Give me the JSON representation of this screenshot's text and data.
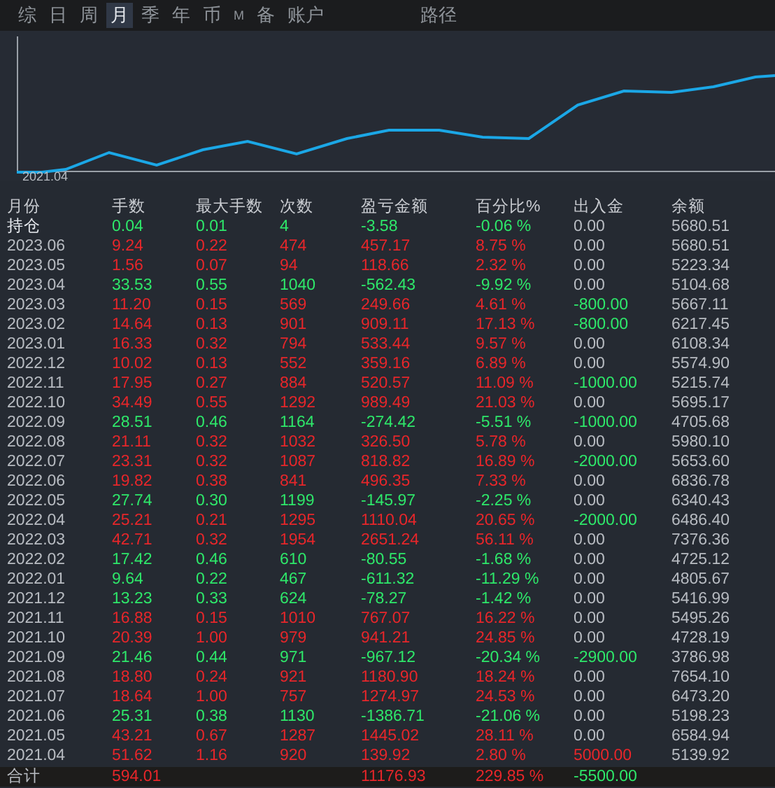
{
  "tabs": [
    {
      "label": "综",
      "selected": false
    },
    {
      "label": "日",
      "selected": false
    },
    {
      "label": "周",
      "selected": false
    },
    {
      "label": "月",
      "selected": true
    },
    {
      "label": "季",
      "selected": false
    },
    {
      "label": "年",
      "selected": false
    },
    {
      "label": "币",
      "selected": false
    },
    {
      "label": "M",
      "selected": false,
      "kind": "small"
    },
    {
      "label": "备",
      "selected": false
    },
    {
      "label": "账户",
      "selected": false
    },
    {
      "label": "路径",
      "selected": false,
      "kind": "far"
    }
  ],
  "chart": {
    "start_label": "2021.04"
  },
  "table": {
    "columns": [
      "月份",
      "手数",
      "最大手数",
      "次数",
      "盈亏金额",
      "百分比%",
      "出入金",
      "余额"
    ],
    "rows": [
      {
        "cells": [
          "持仓",
          "0.04",
          "0.01",
          "4",
          "-3.58",
          "-0.06 %",
          "0.00",
          "5680.51"
        ],
        "kind": "loss",
        "deposit": {
          "kind": "none"
        }
      },
      {
        "cells": [
          "2023.06",
          "9.24",
          "0.22",
          "474",
          "457.17",
          "8.75 %",
          "0.00",
          "5680.51"
        ],
        "kind": "gain",
        "deposit": {
          "kind": "none"
        }
      },
      {
        "cells": [
          "2023.05",
          "1.56",
          "0.07",
          "94",
          "118.66",
          "2.32 %",
          "0.00",
          "5223.34"
        ],
        "kind": "gain",
        "deposit": {
          "kind": "none"
        }
      },
      {
        "cells": [
          "2023.04",
          "33.53",
          "0.55",
          "1040",
          "-562.43",
          "-9.92 %",
          "0.00",
          "5104.68"
        ],
        "kind": "loss",
        "deposit": {
          "kind": "none"
        }
      },
      {
        "cells": [
          "2023.03",
          "11.20",
          "0.15",
          "569",
          "249.66",
          "4.61 %",
          "-800.00",
          "5667.11"
        ],
        "kind": "gain",
        "deposit": {
          "kind": "out"
        }
      },
      {
        "cells": [
          "2023.02",
          "14.64",
          "0.13",
          "901",
          "909.11",
          "17.13 %",
          "-800.00",
          "6217.45"
        ],
        "kind": "gain",
        "deposit": {
          "kind": "out"
        }
      },
      {
        "cells": [
          "2023.01",
          "16.33",
          "0.32",
          "794",
          "533.44",
          "9.57 %",
          "0.00",
          "6108.34"
        ],
        "kind": "gain",
        "deposit": {
          "kind": "none"
        }
      },
      {
        "cells": [
          "2022.12",
          "10.02",
          "0.13",
          "552",
          "359.16",
          "6.89 %",
          "0.00",
          "5574.90"
        ],
        "kind": "gain",
        "deposit": {
          "kind": "none"
        }
      },
      {
        "cells": [
          "2022.11",
          "17.95",
          "0.27",
          "884",
          "520.57",
          "11.09 %",
          "-1000.00",
          "5215.74"
        ],
        "kind": "gain",
        "deposit": {
          "kind": "out"
        }
      },
      {
        "cells": [
          "2022.10",
          "34.49",
          "0.55",
          "1292",
          "989.49",
          "21.03 %",
          "0.00",
          "5695.17"
        ],
        "kind": "gain",
        "deposit": {
          "kind": "none"
        }
      },
      {
        "cells": [
          "2022.09",
          "28.51",
          "0.46",
          "1164",
          "-274.42",
          "-5.51 %",
          "-1000.00",
          "4705.68"
        ],
        "kind": "loss",
        "deposit": {
          "kind": "out"
        }
      },
      {
        "cells": [
          "2022.08",
          "21.11",
          "0.32",
          "1032",
          "326.50",
          "5.78 %",
          "0.00",
          "5980.10"
        ],
        "kind": "gain",
        "deposit": {
          "kind": "none"
        }
      },
      {
        "cells": [
          "2022.07",
          "23.31",
          "0.32",
          "1087",
          "818.82",
          "16.89 %",
          "-2000.00",
          "5653.60"
        ],
        "kind": "gain",
        "deposit": {
          "kind": "out"
        }
      },
      {
        "cells": [
          "2022.06",
          "19.82",
          "0.38",
          "841",
          "496.35",
          "7.33 %",
          "0.00",
          "6836.78"
        ],
        "kind": "gain",
        "deposit": {
          "kind": "none"
        }
      },
      {
        "cells": [
          "2022.05",
          "27.74",
          "0.30",
          "1199",
          "-145.97",
          "-2.25 %",
          "0.00",
          "6340.43"
        ],
        "kind": "loss",
        "deposit": {
          "kind": "none"
        }
      },
      {
        "cells": [
          "2022.04",
          "25.21",
          "0.21",
          "1295",
          "1110.04",
          "20.65 %",
          "-2000.00",
          "6486.40"
        ],
        "kind": "gain",
        "deposit": {
          "kind": "out"
        }
      },
      {
        "cells": [
          "2022.03",
          "42.71",
          "0.32",
          "1954",
          "2651.24",
          "56.11 %",
          "0.00",
          "7376.36"
        ],
        "kind": "gain",
        "deposit": {
          "kind": "none"
        }
      },
      {
        "cells": [
          "2022.02",
          "17.42",
          "0.46",
          "610",
          "-80.55",
          "-1.68 %",
          "0.00",
          "4725.12"
        ],
        "kind": "loss",
        "deposit": {
          "kind": "none"
        }
      },
      {
        "cells": [
          "2022.01",
          "9.64",
          "0.22",
          "467",
          "-611.32",
          "-11.29 %",
          "0.00",
          "4805.67"
        ],
        "kind": "loss",
        "deposit": {
          "kind": "none"
        }
      },
      {
        "cells": [
          "2021.12",
          "13.23",
          "0.33",
          "624",
          "-78.27",
          "-1.42 %",
          "0.00",
          "5416.99"
        ],
        "kind": "loss",
        "deposit": {
          "kind": "none"
        }
      },
      {
        "cells": [
          "2021.11",
          "16.88",
          "0.15",
          "1010",
          "767.07",
          "16.22 %",
          "0.00",
          "5495.26"
        ],
        "kind": "gain",
        "deposit": {
          "kind": "none"
        }
      },
      {
        "cells": [
          "2021.10",
          "20.39",
          "1.00",
          "979",
          "941.21",
          "24.85 %",
          "0.00",
          "4728.19"
        ],
        "kind": "gain",
        "deposit": {
          "kind": "none"
        }
      },
      {
        "cells": [
          "2021.09",
          "21.46",
          "0.44",
          "971",
          "-967.12",
          "-20.34 %",
          "-2900.00",
          "3786.98"
        ],
        "kind": "loss",
        "deposit": {
          "kind": "out"
        }
      },
      {
        "cells": [
          "2021.08",
          "18.80",
          "0.24",
          "921",
          "1180.90",
          "18.24 %",
          "0.00",
          "7654.10"
        ],
        "kind": "gain",
        "deposit": {
          "kind": "none"
        }
      },
      {
        "cells": [
          "2021.07",
          "18.64",
          "1.00",
          "757",
          "1274.97",
          "24.53 %",
          "0.00",
          "6473.20"
        ],
        "kind": "gain",
        "deposit": {
          "kind": "none"
        }
      },
      {
        "cells": [
          "2021.06",
          "25.31",
          "0.38",
          "1130",
          "-1386.71",
          "-21.06 %",
          "0.00",
          "5198.23"
        ],
        "kind": "loss",
        "deposit": {
          "kind": "none"
        }
      },
      {
        "cells": [
          "2021.05",
          "43.21",
          "0.67",
          "1287",
          "1445.02",
          "28.11 %",
          "0.00",
          "6584.94"
        ],
        "kind": "gain",
        "deposit": {
          "kind": "none"
        }
      },
      {
        "cells": [
          "2021.04",
          "51.62",
          "1.16",
          "920",
          "139.92",
          "2.80 %",
          "5000.00",
          "5139.92"
        ],
        "kind": "gain",
        "deposit": {
          "kind": "in"
        }
      }
    ],
    "total": {
      "label": "合计",
      "lots": "594.01",
      "profit": "11176.93",
      "percent": "229.85 %",
      "flow": "-5500.00"
    }
  }
}
